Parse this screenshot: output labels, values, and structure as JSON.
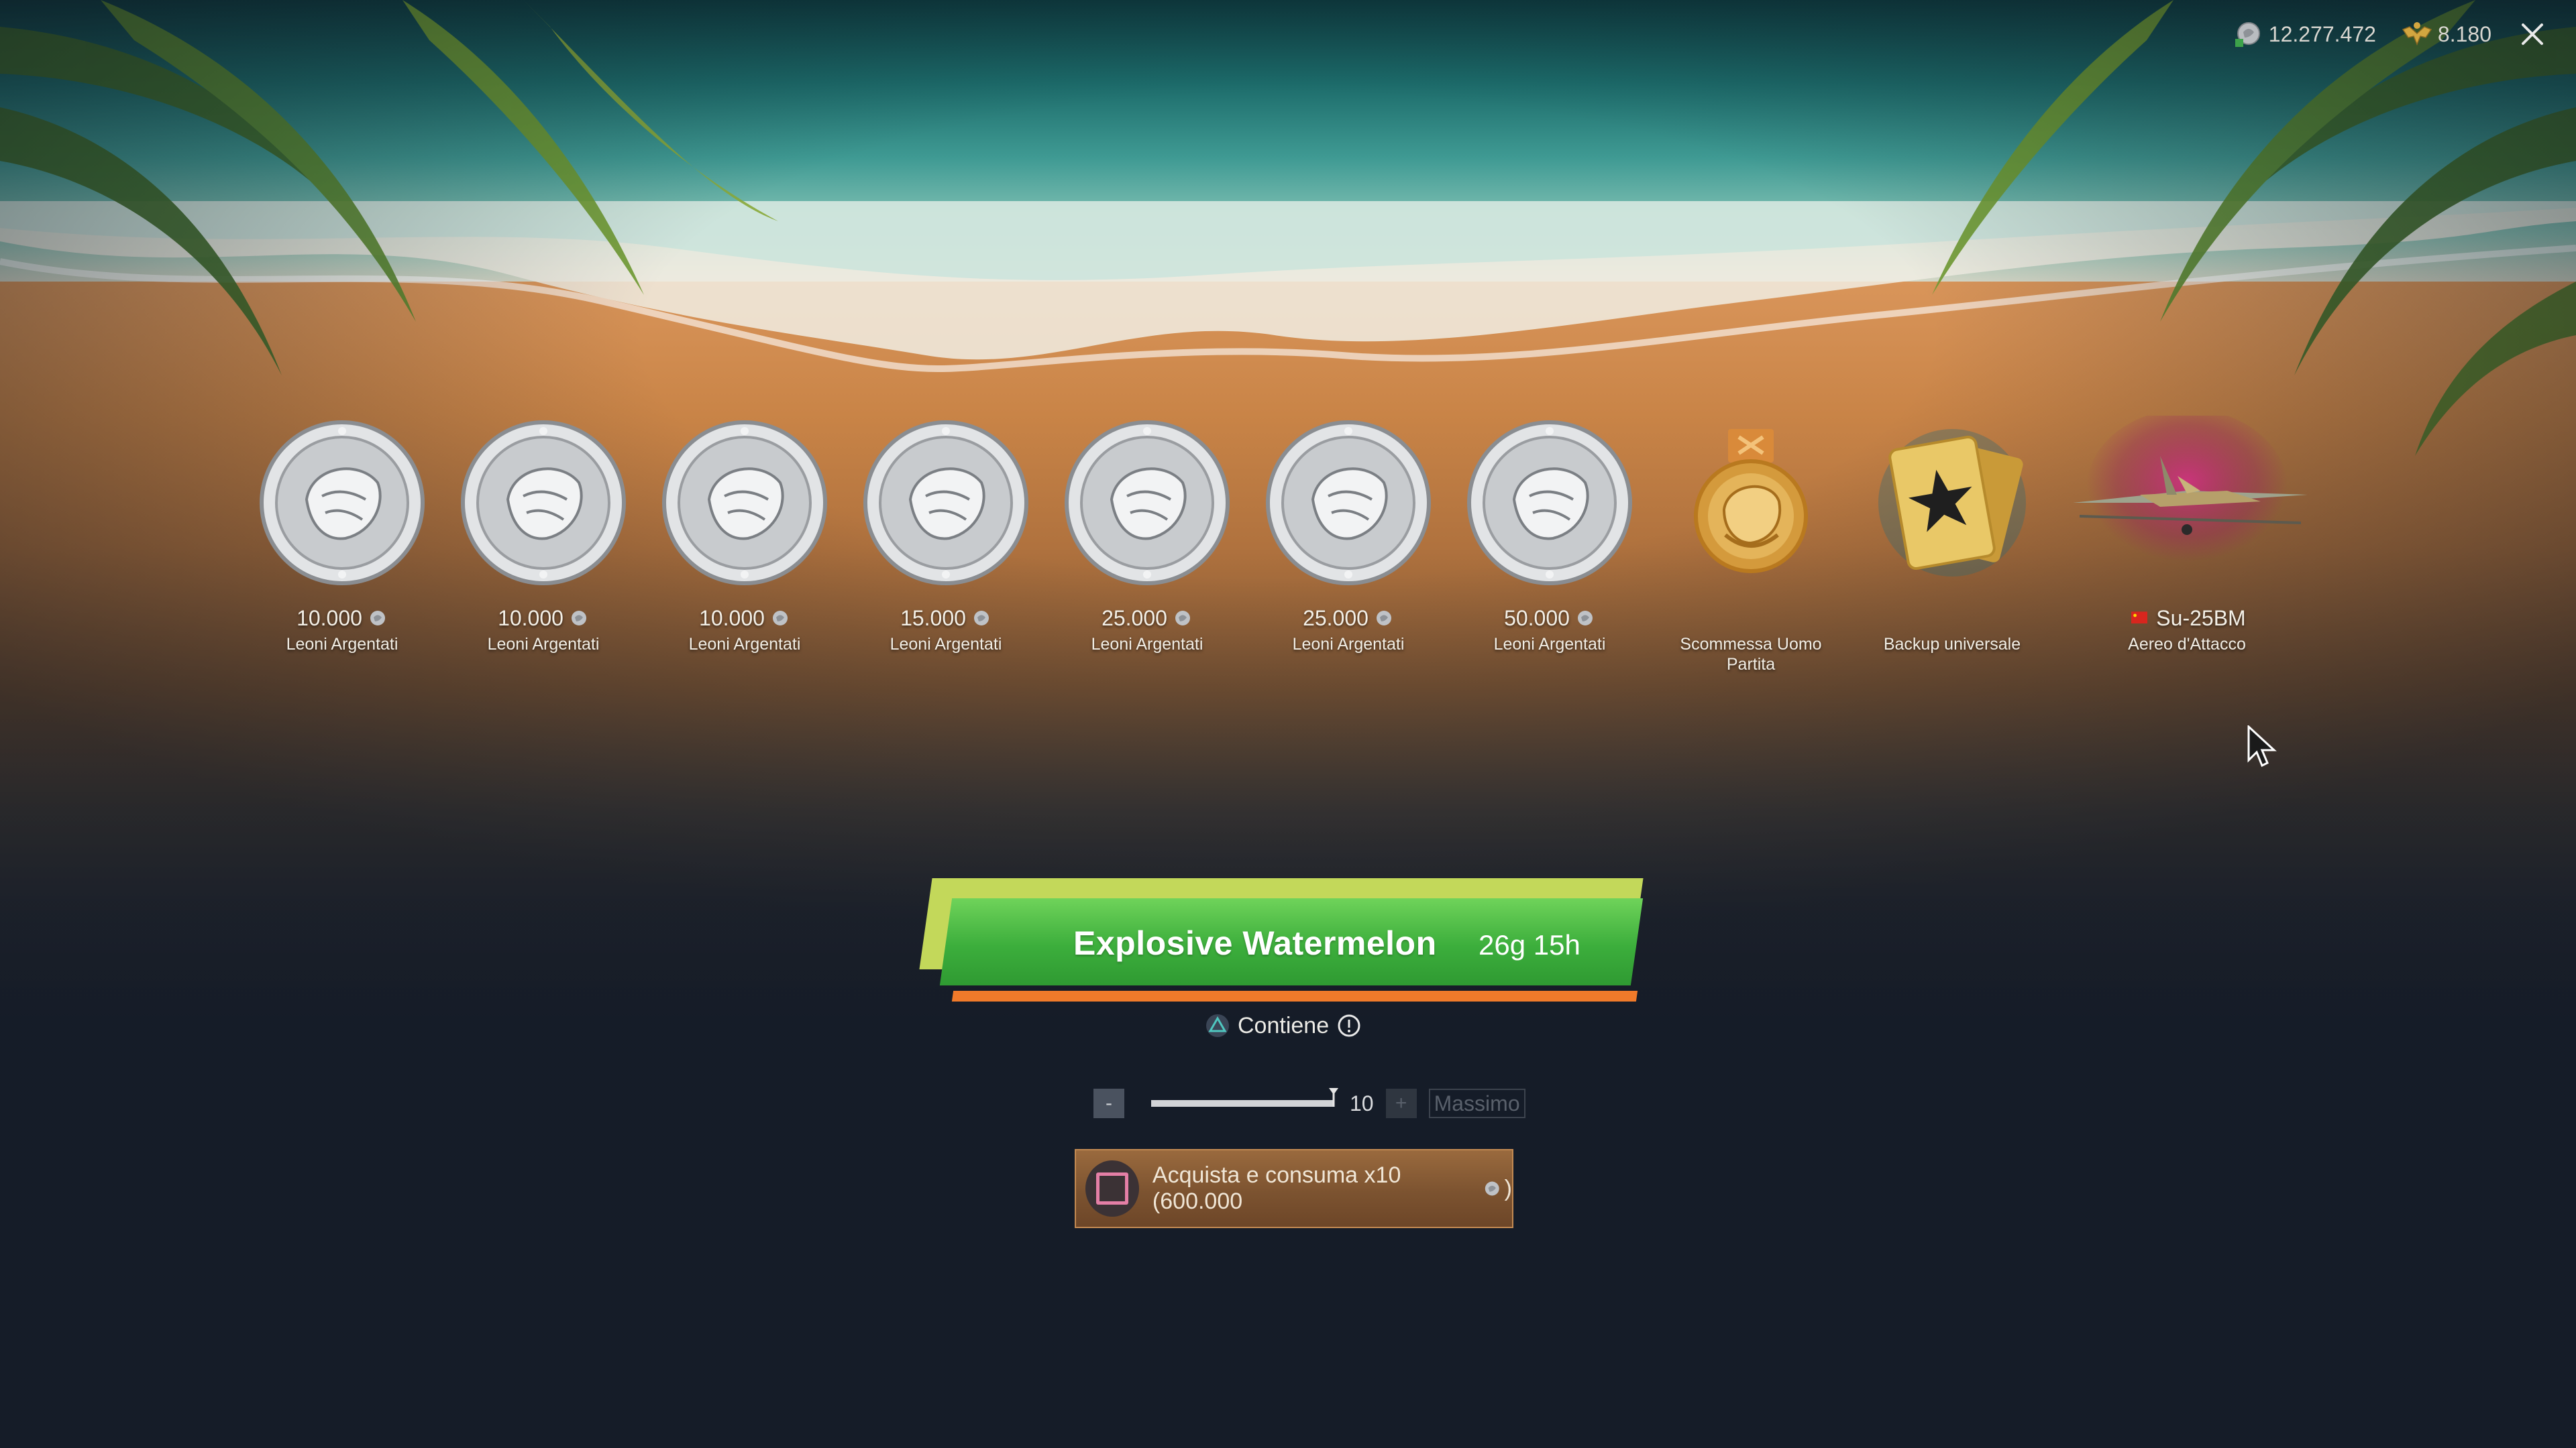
{
  "topbar": {
    "silver_lions": "12.277.472",
    "golden_eagles": "8.180",
    "silver_icon": "silver-lions-icon",
    "gold_icon": "golden-eagles-icon",
    "close_icon": "close-icon"
  },
  "rewards": [
    {
      "amount": "10.000",
      "label": "Leoni Argentati",
      "type": "silver-lion-coin"
    },
    {
      "amount": "10.000",
      "label": "Leoni Argentati",
      "type": "silver-lion-coin"
    },
    {
      "amount": "10.000",
      "label": "Leoni Argentati",
      "type": "silver-lion-coin"
    },
    {
      "amount": "15.000",
      "label": "Leoni Argentati",
      "type": "silver-lion-coin"
    },
    {
      "amount": "25.000",
      "label": "Leoni Argentati",
      "type": "silver-lion-coin"
    },
    {
      "amount": "25.000",
      "label": "Leoni Argentati",
      "type": "silver-lion-coin"
    },
    {
      "amount": "50.000",
      "label": "Leoni Argentati",
      "type": "silver-lion-coin"
    },
    {
      "amount": "",
      "label": "Scommessa Uomo Partita",
      "type": "wager-medal"
    },
    {
      "amount": "",
      "label": "Backup universale",
      "type": "universal-backup-card"
    },
    {
      "amount": "Su-25BM",
      "label": "Aereo d'Attacco",
      "type": "aircraft",
      "flag": "china-flag-icon"
    }
  ],
  "event": {
    "title": "Explosive Watermelon",
    "timer": "26g 15h",
    "accent_green": "#3cae3c",
    "accent_lime": "#c3d85a",
    "accent_orange": "#f07a2a"
  },
  "contains": {
    "label": "Contiene",
    "button_icon": "triangle-button-icon",
    "info_icon": "info-icon"
  },
  "quantity": {
    "minus_label": "-",
    "plus_label": "+",
    "value": "10",
    "max_label": "Massimo",
    "fill_fraction": 1.0
  },
  "buy": {
    "label": "Acquista e consuma x10 (600.000",
    "suffix": ")",
    "button_icon": "square-button-icon"
  }
}
